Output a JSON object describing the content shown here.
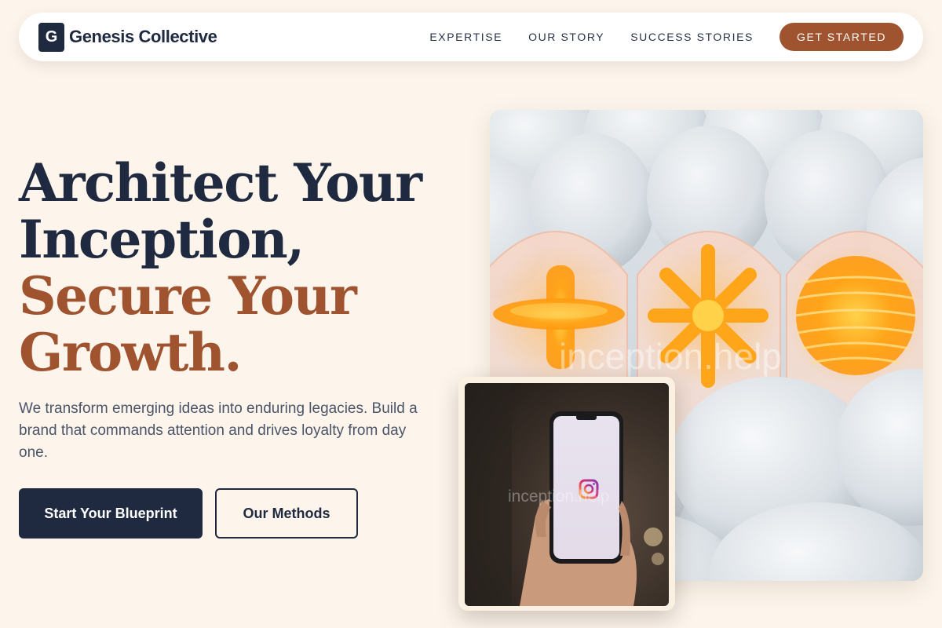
{
  "nav": {
    "logo_letter": "G",
    "brand_name": "Genesis Collective",
    "links": [
      "EXPERTISE",
      "OUR STORY",
      "SUCCESS STORIES"
    ],
    "cta_label": "GET STARTED"
  },
  "hero": {
    "headline_line1": "Architect Your",
    "headline_line2": "Inception,",
    "headline_line3": "Secure Your",
    "headline_line4": "Growth.",
    "subtext": "We transform emerging ideas into enduring legacies. Build a brand that commands attention and drives loyalty from day one.",
    "primary_button": "Start Your Blueprint",
    "secondary_button": "Our Methods"
  },
  "images": {
    "main_watermark": "inception.help",
    "phone_watermark": "inception.help"
  },
  "colors": {
    "background": "#fdf5ec",
    "navy": "#1f2a40",
    "accent": "#a0532f",
    "orange_glow": "#ffa51a"
  }
}
